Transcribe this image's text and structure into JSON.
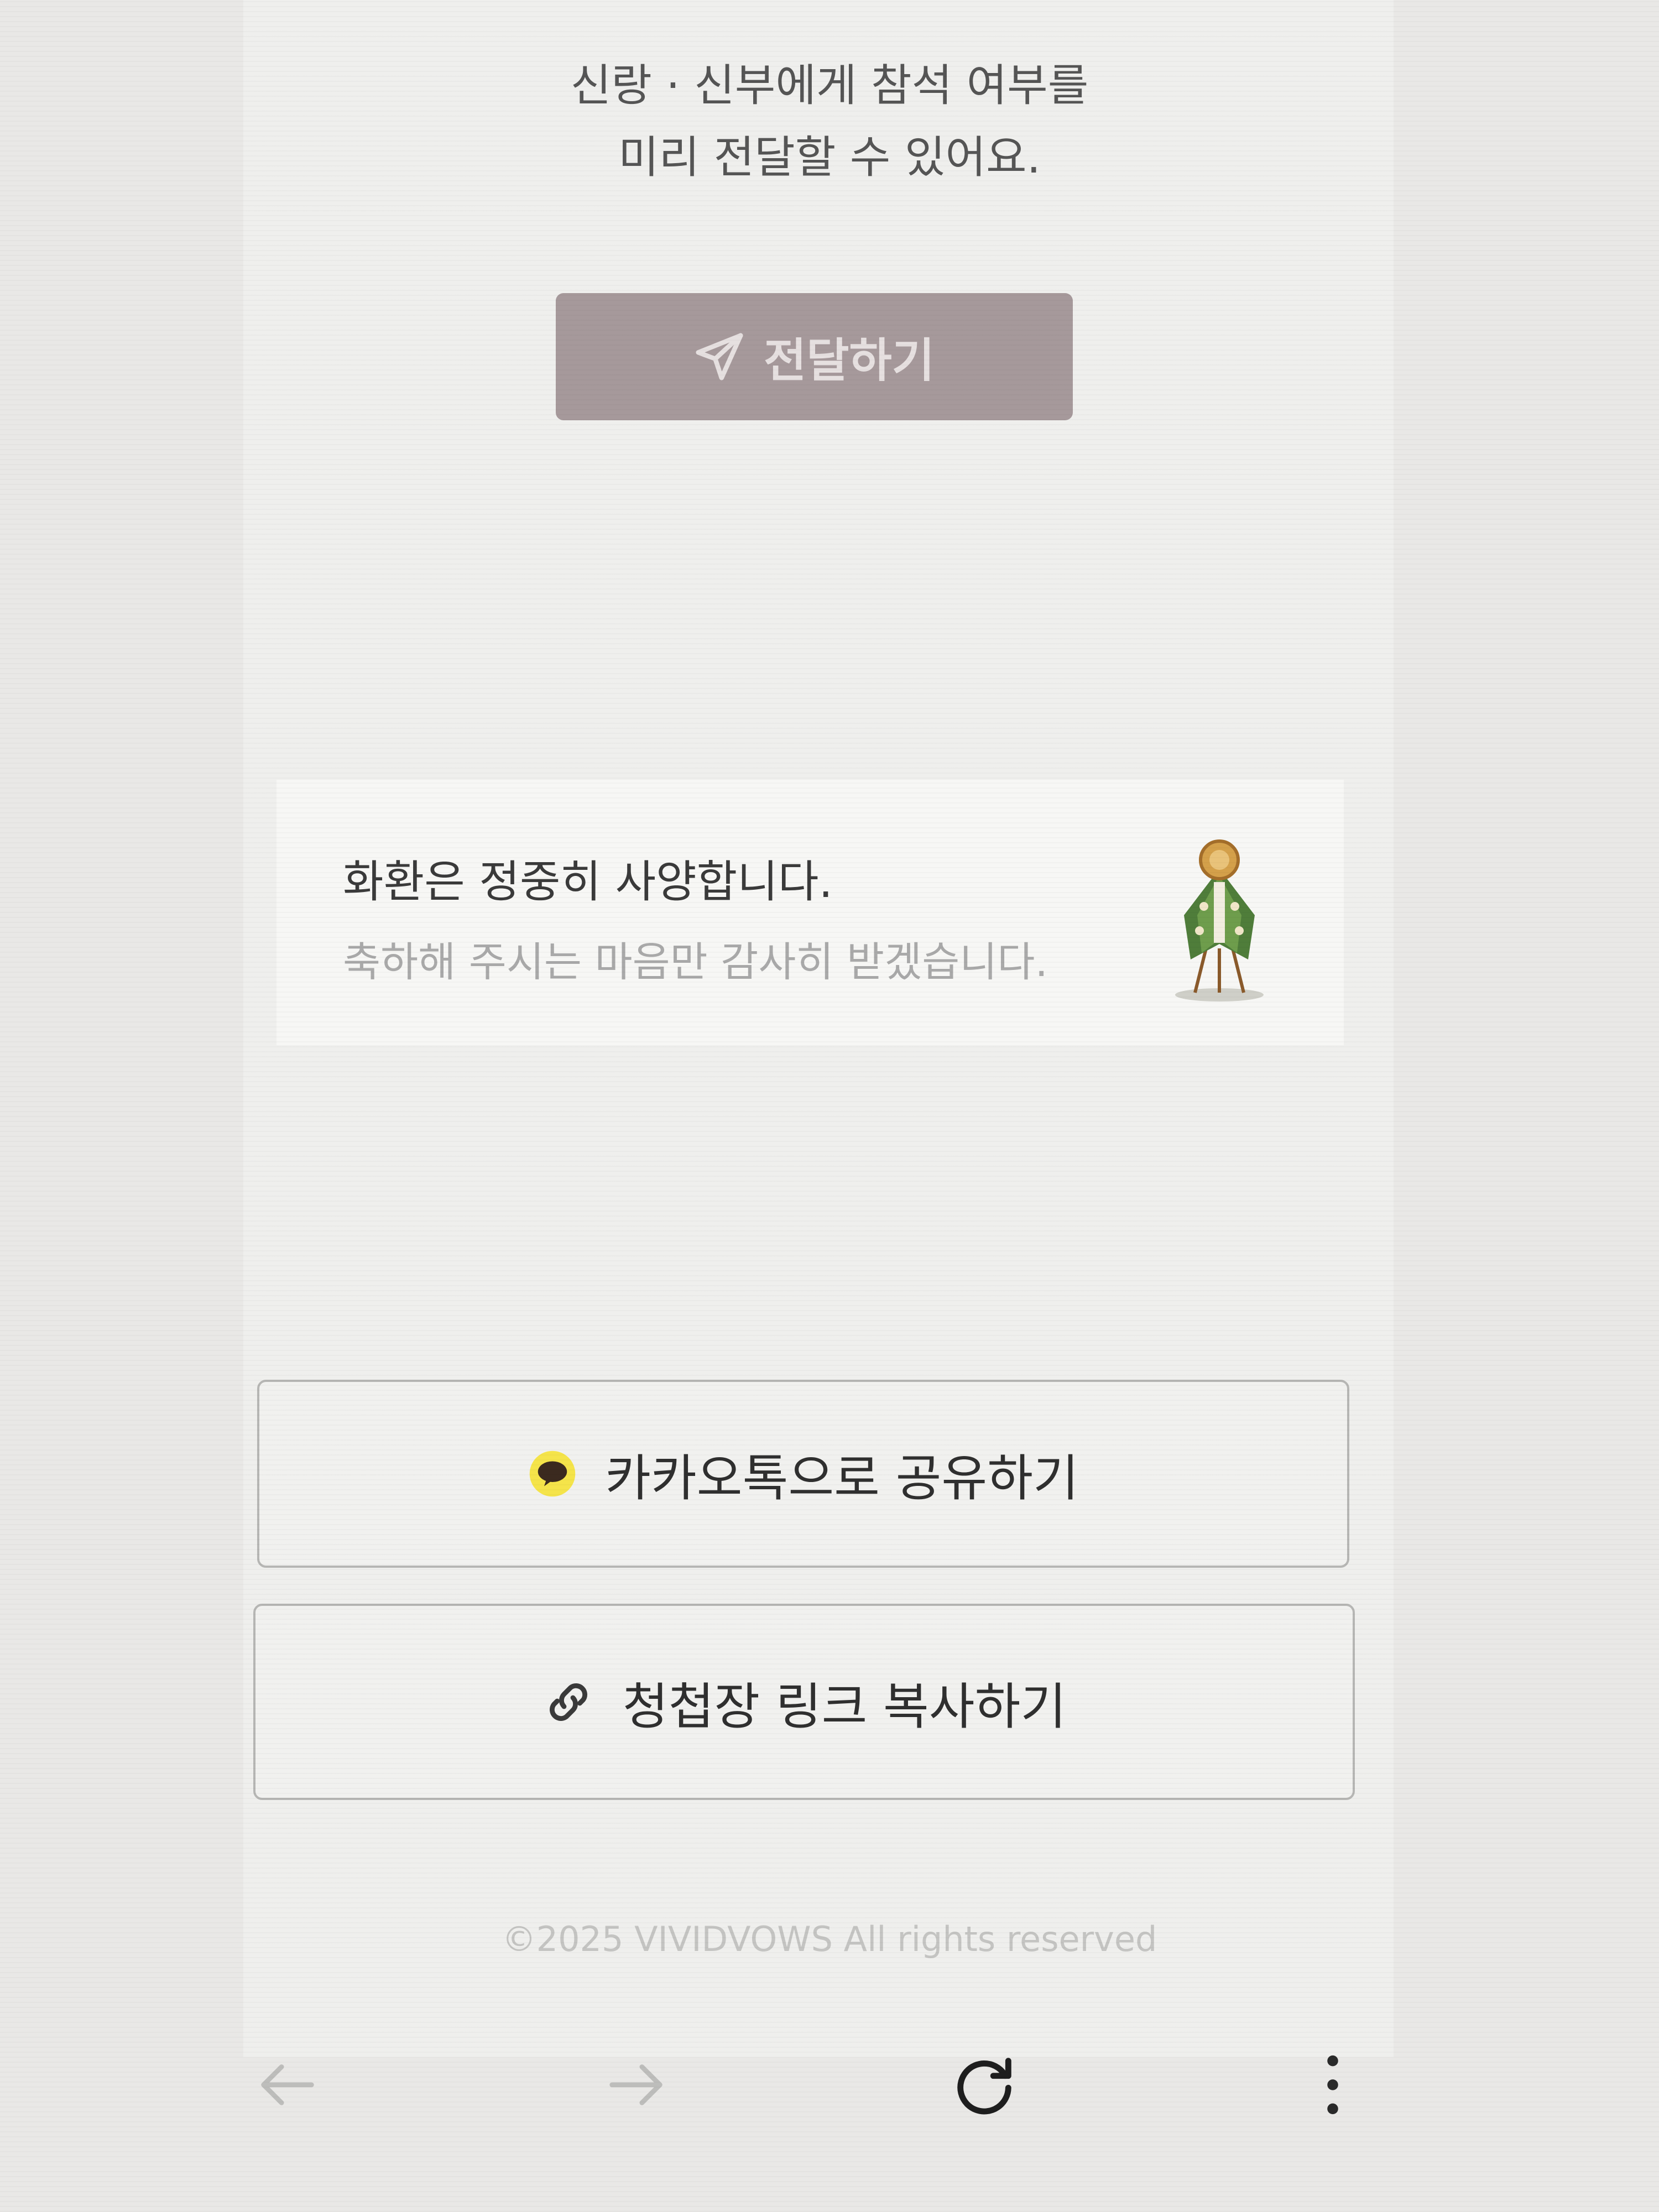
{
  "rsvp": {
    "line1": "신랑 · 신부에게 참석 여부를",
    "line2": "미리 전달할 수 있어요.",
    "send_button_label": "전달하기",
    "send_icon": "paper-plane-icon"
  },
  "flower_notice": {
    "title": "화환은 정중히 사양합니다.",
    "subtitle": "축하해 주시는 마음만 감사히 받겠습니다.",
    "image_icon": "flower-wreath-icon"
  },
  "share": {
    "kakao_label": "카카오톡으로 공유하기",
    "kakao_icon": "kakaotalk-icon",
    "link_label": "청첩장 링크 복사하기",
    "link_icon": "link-icon"
  },
  "footer": {
    "copyright": "©2025 VIVIDVOWS All rights reserved"
  },
  "browser_nav": {
    "back_icon": "arrow-left-icon",
    "forward_icon": "arrow-right-icon",
    "reload_icon": "reload-icon",
    "menu_icon": "more-vertical-icon"
  },
  "colors": {
    "send_button_bg": "#a6999b",
    "kakao_yellow": "#f5e44a",
    "page_bg": "#efefed"
  }
}
